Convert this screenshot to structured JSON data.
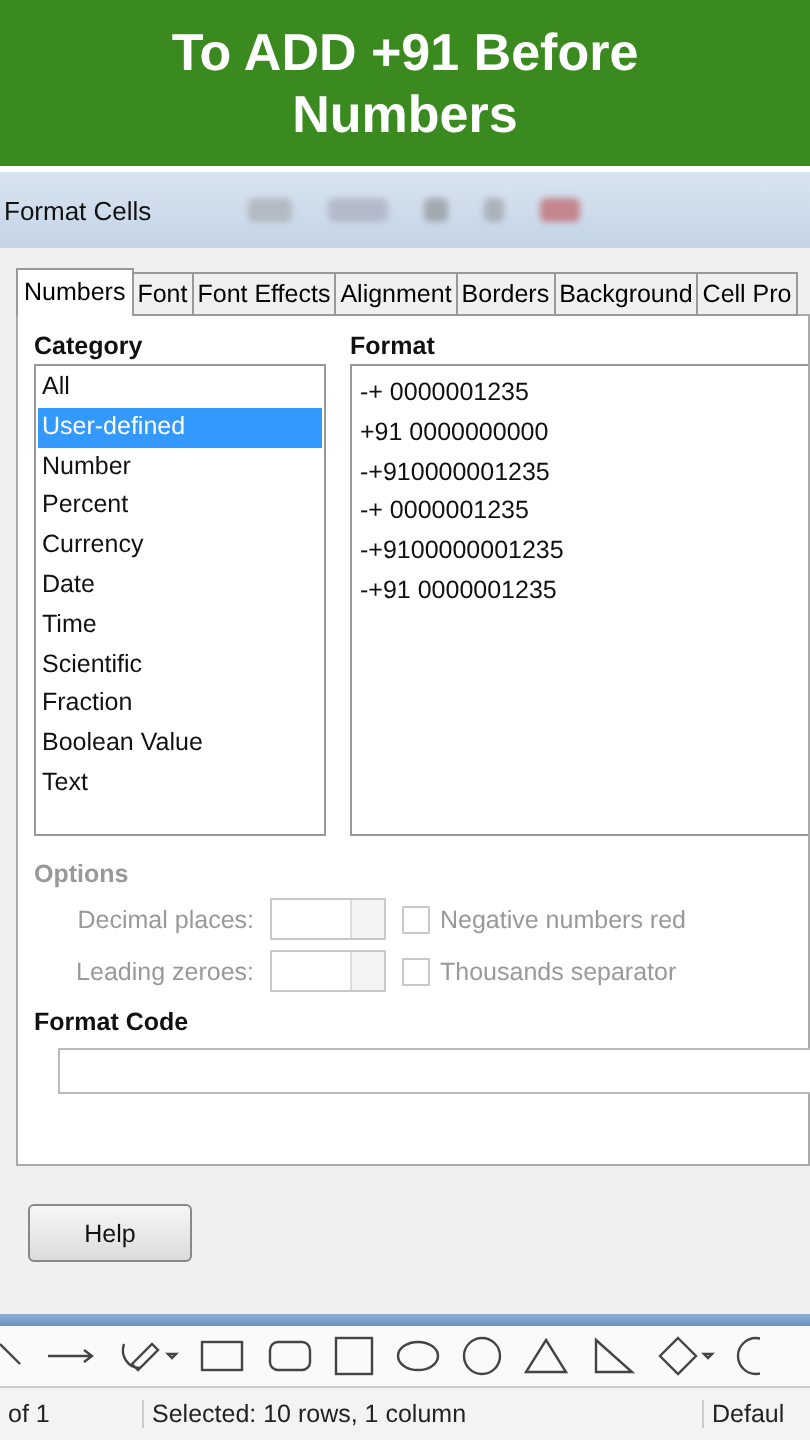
{
  "banner": {
    "lines": [
      "To ADD +91 Before",
      "Numbers"
    ]
  },
  "window": {
    "title": "Format Cells"
  },
  "tabs": [
    {
      "label": "Numbers",
      "selected": true
    },
    {
      "label": "Font",
      "selected": false
    },
    {
      "label": "Font Effects",
      "selected": false
    },
    {
      "label": "Alignment",
      "selected": false
    },
    {
      "label": "Borders",
      "selected": false
    },
    {
      "label": "Background",
      "selected": false
    },
    {
      "label": "Cell Pro",
      "selected": false
    }
  ],
  "category": {
    "label": "Category",
    "items": [
      {
        "label": "All",
        "selected": false
      },
      {
        "label": "User-defined",
        "selected": true
      },
      {
        "label": "Number",
        "selected": false
      },
      {
        "label": "Percent",
        "selected": false
      },
      {
        "label": "Currency",
        "selected": false
      },
      {
        "label": "Date",
        "selected": false
      },
      {
        "label": "Time",
        "selected": false
      },
      {
        "label": "Scientific",
        "selected": false
      },
      {
        "label": "Fraction",
        "selected": false
      },
      {
        "label": "Boolean Value",
        "selected": false
      },
      {
        "label": "Text",
        "selected": false
      }
    ]
  },
  "format": {
    "label": "Format",
    "items": [
      "-+ 0000001235",
      "+91 0000000000",
      "-+910000001235",
      "-+ 0000001235",
      "-+9100000001235",
      "-+91 0000001235"
    ]
  },
  "options": {
    "label": "Options",
    "disabled": true,
    "spinners": [
      {
        "label": "Decimal places:",
        "disabled": true
      },
      {
        "label": "Leading zeroes:",
        "disabled": true
      }
    ],
    "checkboxes": [
      {
        "label": "Negative numbers red",
        "checked": false,
        "disabled": true
      },
      {
        "label": "Thousands separator",
        "checked": false,
        "disabled": true
      }
    ]
  },
  "format_code": {
    "label": "Format Code"
  },
  "buttons": [
    "Help"
  ],
  "status_bar": [
    "of 1",
    "Selected: 10 rows, 1 column",
    "Defaul"
  ]
}
